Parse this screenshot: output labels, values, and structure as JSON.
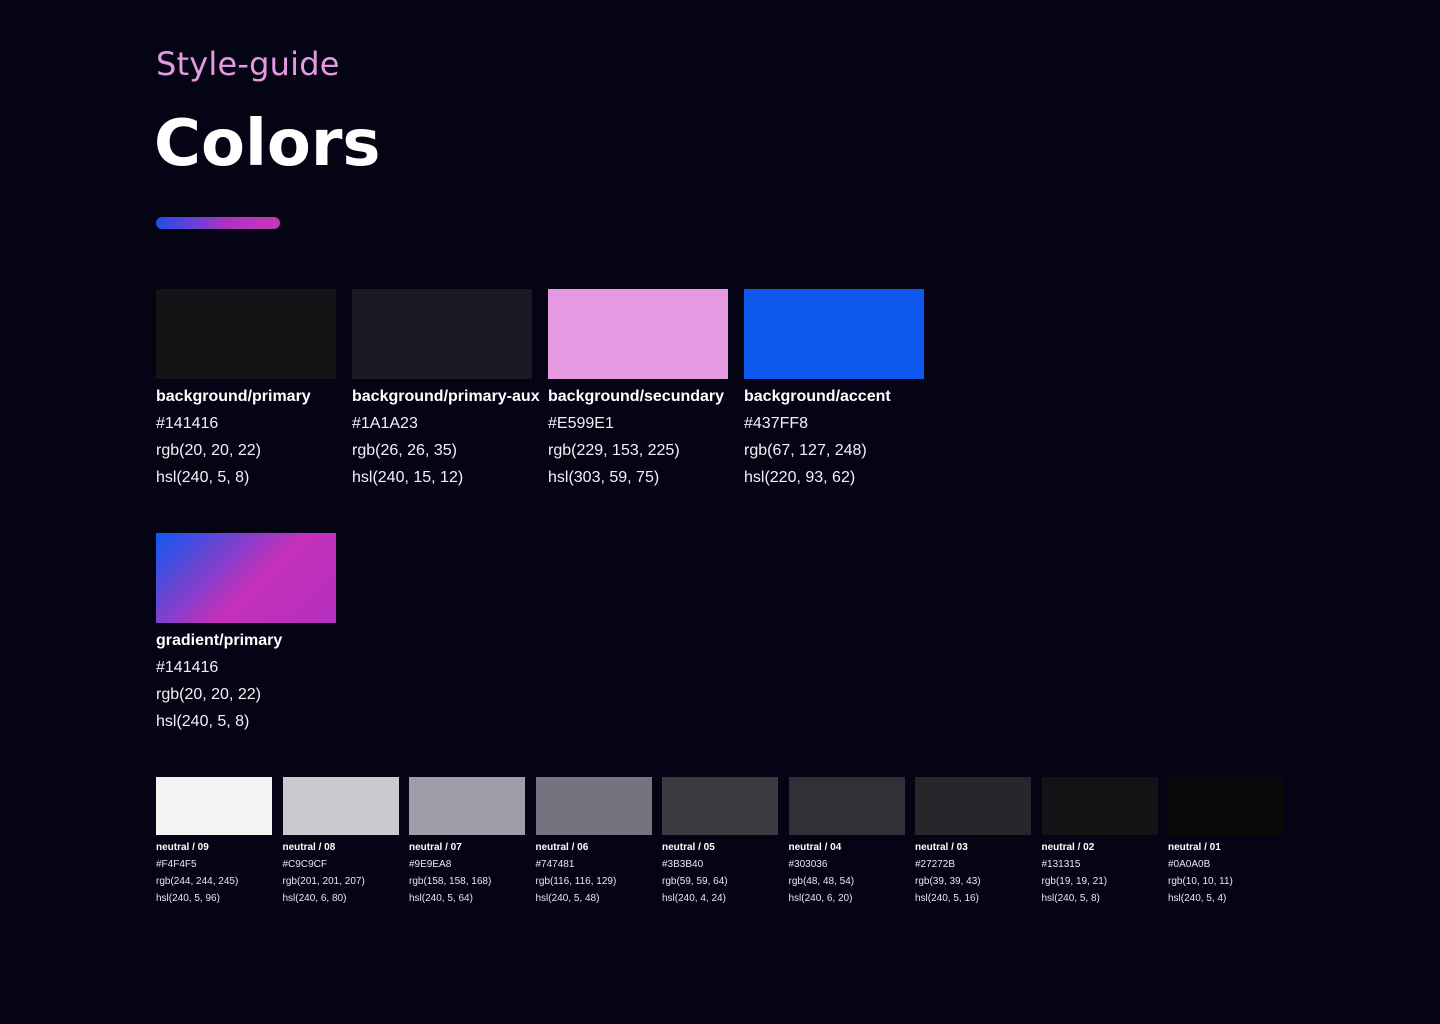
{
  "header": {
    "subtitle": "Style-guide",
    "title": "Colors",
    "accent_gradient": [
      "#1F4FE8",
      "#C43AB8"
    ]
  },
  "primary_colors": [
    {
      "name": "background/primary",
      "hex": "#141416",
      "rgb": "rgb(20, 20, 22)",
      "hsl": "hsl(240, 5, 8)",
      "swatch": "#141416"
    },
    {
      "name": "background/primary-aux",
      "hex": "#1A1A23",
      "rgb": "rgb(26, 26, 35)",
      "hsl": "hsl(240, 15, 12)",
      "swatch": "#1A1A23"
    },
    {
      "name": "background/secundary",
      "hex": "#E599E1",
      "rgb": "rgb(229, 153, 225)",
      "hsl": "hsl(303, 59, 75)",
      "swatch": "#E599E1"
    },
    {
      "name": "background/accent",
      "hex": "#437FF8",
      "rgb": "rgb(67, 127, 248)",
      "hsl": "hsl(220, 93, 62)",
      "swatch": "#0E57EC"
    }
  ],
  "gradient": {
    "name": "gradient/primary",
    "hex": "#141416",
    "rgb": "rgb(20, 20, 22)",
    "hsl": "hsl(240, 5, 8)",
    "stops": [
      "#0E5AF0",
      "#C530B8",
      "#B42FC0"
    ]
  },
  "neutrals": [
    {
      "name": "neutral / 09",
      "hex": "#F4F4F5",
      "rgb": "rgb(244, 244, 245)",
      "hsl": "hsl(240, 5, 96)",
      "swatch": "#F4F4F5"
    },
    {
      "name": "neutral / 08",
      "hex": "#C9C9CF",
      "rgb": "rgb(201, 201, 207)",
      "hsl": "hsl(240, 6, 80)",
      "swatch": "#C9C9CF"
    },
    {
      "name": "neutral / 07",
      "hex": "#9E9EA8",
      "rgb": "rgb(158, 158, 168)",
      "hsl": "hsl(240, 5, 64)",
      "swatch": "#9E9EA8"
    },
    {
      "name": "neutral / 06",
      "hex": "#747481",
      "rgb": "rgb(116, 116, 129)",
      "hsl": "hsl(240, 5, 48)",
      "swatch": "#747481"
    },
    {
      "name": "neutral / 05",
      "hex": "#3B3B40",
      "rgb": "rgb(59, 59, 64)",
      "hsl": "hsl(240, 4, 24)",
      "swatch": "#3B3B40"
    },
    {
      "name": "neutral / 04",
      "hex": "#303036",
      "rgb": "rgb(48, 48, 54)",
      "hsl": "hsl(240, 6, 20)",
      "swatch": "#303036"
    },
    {
      "name": "neutral / 03",
      "hex": "#27272B",
      "rgb": "rgb(39, 39, 43)",
      "hsl": "hsl(240, 5, 16)",
      "swatch": "#27272B"
    },
    {
      "name": "neutral / 02",
      "hex": "#131315",
      "rgb": "rgb(19, 19, 21)",
      "hsl": "hsl(240, 5, 8)",
      "swatch": "#131315"
    },
    {
      "name": "neutral / 01",
      "hex": "#0A0A0B",
      "rgb": "rgb(10, 10, 11)",
      "hsl": "hsl(240, 5, 4)",
      "swatch": "#0A0A0B"
    }
  ]
}
